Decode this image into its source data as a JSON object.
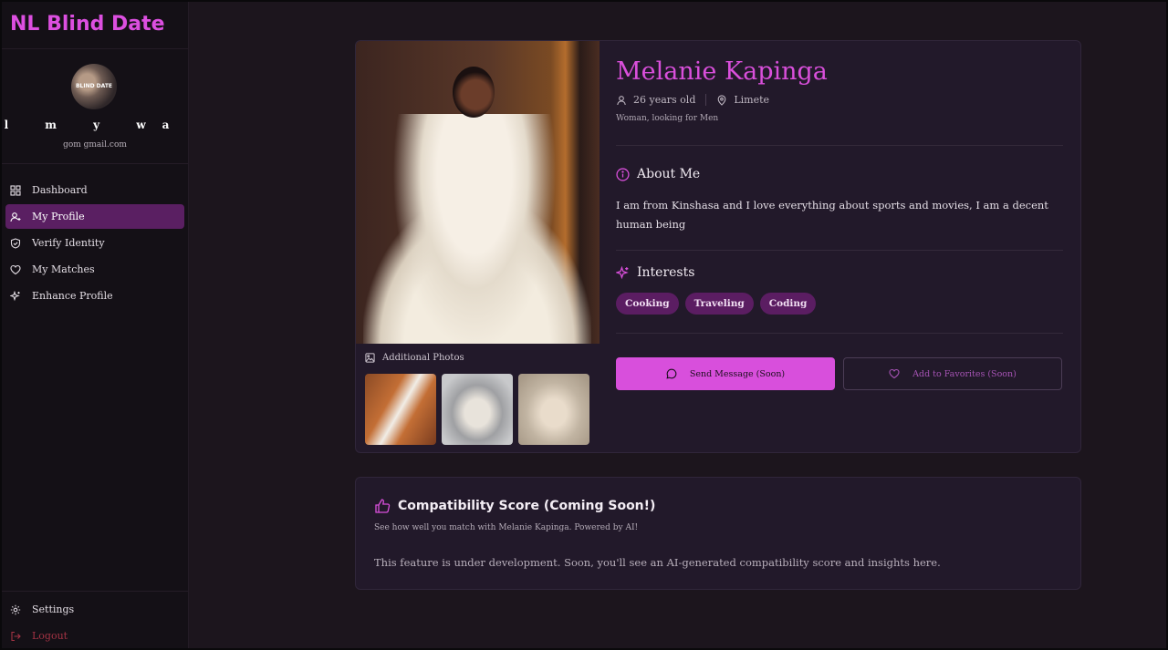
{
  "app": {
    "brand": "NL Blind Date"
  },
  "user": {
    "avatar_text": "BLIND DATE",
    "name": "l  m  y  wa",
    "email": "gom   gmail.com"
  },
  "nav": {
    "items": [
      {
        "label": "Dashboard",
        "icon": "grid-icon"
      },
      {
        "label": "My Profile",
        "icon": "user-icon",
        "active": true
      },
      {
        "label": "Verify Identity",
        "icon": "shield-icon"
      },
      {
        "label": "My Matches",
        "icon": "heart-icon"
      },
      {
        "label": "Enhance Profile",
        "icon": "sparkle-icon"
      }
    ],
    "settings": "Settings",
    "logout": "Logout"
  },
  "profile": {
    "name": "Melanie Kapinga",
    "age": "26 years old",
    "location": "Limete",
    "looking": "Woman, looking for Men",
    "about_title": "About Me",
    "about": "I am from Kinshasa and I love everything about sports and movies,  I am a decent human being",
    "interests_title": "Interests",
    "interests": [
      "Cooking",
      "Traveling",
      "Coding"
    ],
    "additional_photos_label": "Additional Photos",
    "send_message": "Send Message (Soon)",
    "add_favorites": "Add to Favorites (Soon)"
  },
  "compatibility": {
    "title": "Compatibility Score (Coming Soon!)",
    "subtitle": "See how well you match with Melanie Kapinga. Powered by AI!",
    "text": "This feature is under development. Soon, you'll see an AI-generated compatibility score and insights here."
  },
  "colors": {
    "accent": "#dc4fe0",
    "active_nav": "#5a1f62",
    "chip": "#5b1d62",
    "background": "#1c151d"
  }
}
